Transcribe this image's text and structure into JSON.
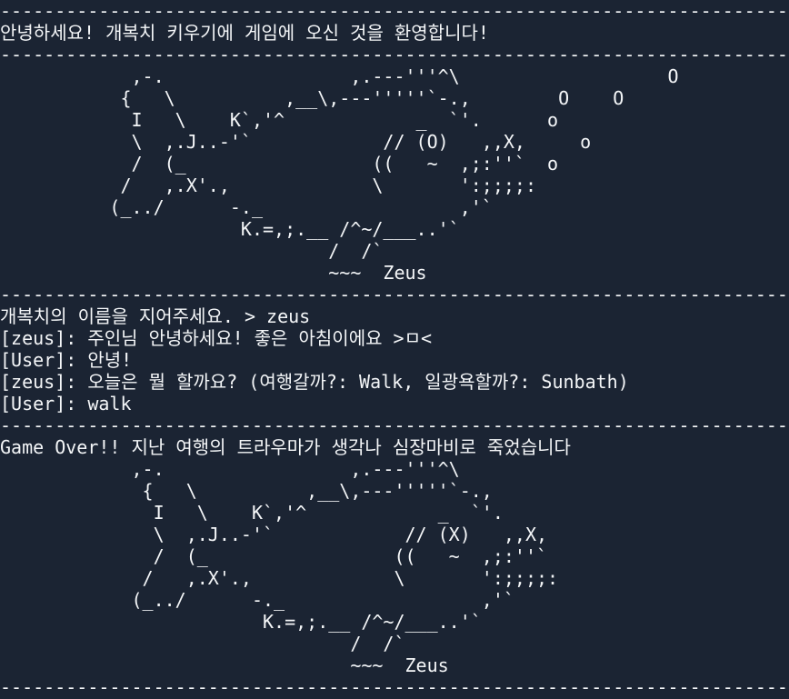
{
  "terminal": {
    "lines": [
      "-----------------------------------------------------------------------------",
      "안녕하세요! 개복치 키우기에 게임에 오신 것을 환영합니다!",
      "-----------------------------------------------------------------------------",
      "            ,-.                 ,.---'''^\\                   O",
      "           {   \\          ,__\\,---'''''`-.,        O    O",
      "            I   \\    K`,'^            _  `'.      o",
      "            \\  ,.J..-'`            // (O)   ,,X,     o",
      "            /  (_                 ((   ~  ,;:''`  o",
      "           /   ,.X'.,             \\       ':;;;;:",
      "          (_../      -._                  ,'`",
      "                      K.=,;.__ /^~/___..'`",
      "                              /  /`",
      "                              ~~~  Zeus",
      "-----------------------------------------------------------------------------",
      "개복치의 이름을 지어주세요. > zeus",
      "[zeus]: 주인님 안녕하세요! 좋은 아침이에요 >ㅁ<",
      "[User]: 안녕!",
      "[zeus]: 오늘은 뭘 할까요? (여행갈까?: Walk, 일광욕할까?: Sunbath)",
      "[User]: walk",
      "-----------------------------------------------------------------------------",
      "Game Over!! 지난 여행의 트라우마가 생각나 심장마비로 죽었습니다",
      "            ,-.                 ,.---'''^\\",
      "             {   \\          ,__\\,---'''''`-.,",
      "              I   \\    K`,'^            _  `'.",
      "              \\  ,.J..-'`            // (X)   ,,X,",
      "              /  (_                 ((   ~  ,;:''`",
      "             /   ,.X'.,             \\       ':;;;;:",
      "            (_../      -._                  ,'`",
      "                        K.=,;.__ /^~/___..'`",
      "                                /  /`",
      "                                ~~~  Zeus",
      "-----------------------------------------------------------------------------"
    ]
  }
}
